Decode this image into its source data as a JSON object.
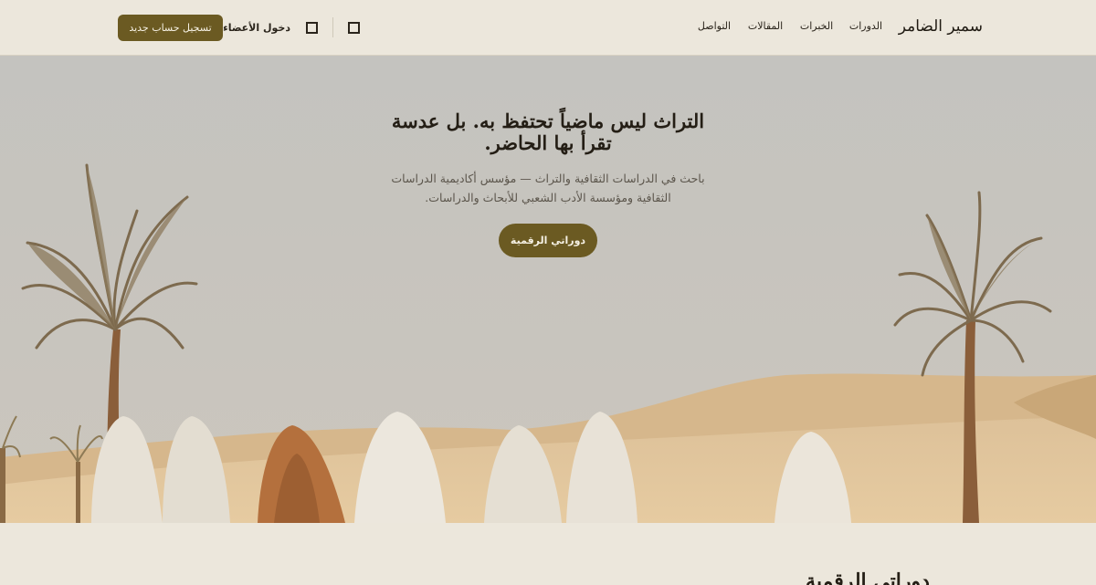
{
  "header": {
    "brand": "سمير الضامر",
    "nav": [
      "الدورات",
      "الخبرات",
      "المقالات",
      "التواصل"
    ],
    "login_label": "دخول الأعضاء",
    "signup_label": "تسجيل حساب جديد",
    "icons": [
      "square-icon",
      "square-icon"
    ]
  },
  "hero": {
    "title": "التراث ليس ماضياً تحتفظ به. بل عدسة تقرأ بها الحاضر.",
    "subtitle": "باحث في الدراسات الثقافية والتراث — مؤسس أكاديمية الدراسات الثقافية ومؤسسة الأدب الشعبي للأبحاث والدراسات.",
    "cta_label": "دوراتي الرقمية"
  },
  "section": {
    "heading": "دوراتي الرقمية"
  },
  "colors": {
    "background": "#ece7dc",
    "accent": "#6b5a22",
    "text": "#2a241b",
    "sky": "#c6c4bf",
    "sand": "#dcbf94"
  }
}
